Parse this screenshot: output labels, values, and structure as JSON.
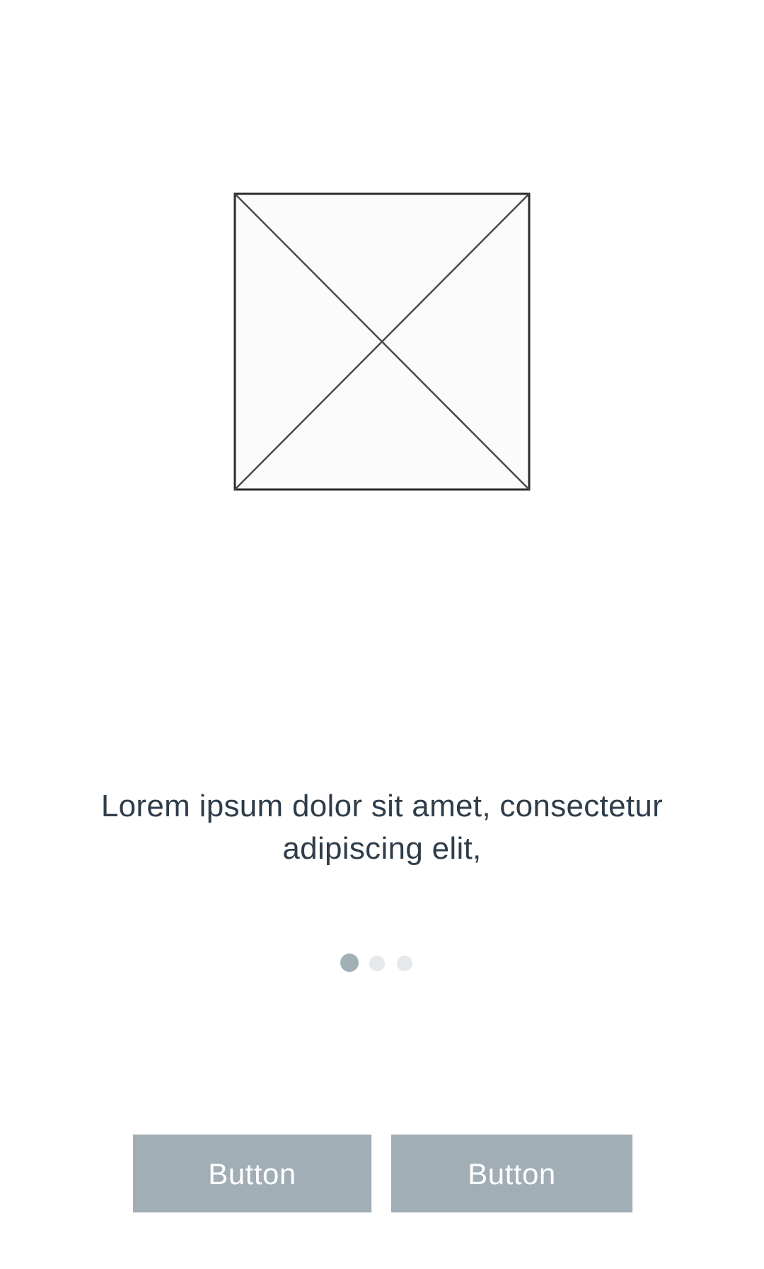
{
  "image": {
    "icon": "image-placeholder-icon",
    "frame_color": "#2b2b2b",
    "fill_color": "#fbfbfb"
  },
  "caption": {
    "text": "Lorem ipsum dolor sit amet, consectetur adipiscing elit,"
  },
  "pager": {
    "count": 3,
    "active_index": 0,
    "active_color": "#a3afb7",
    "inactive_color": "#e6e9ec"
  },
  "buttons": {
    "left_label": "Button",
    "right_label": "Button",
    "background": "#a2aeb5",
    "text_color": "#ffffff"
  }
}
